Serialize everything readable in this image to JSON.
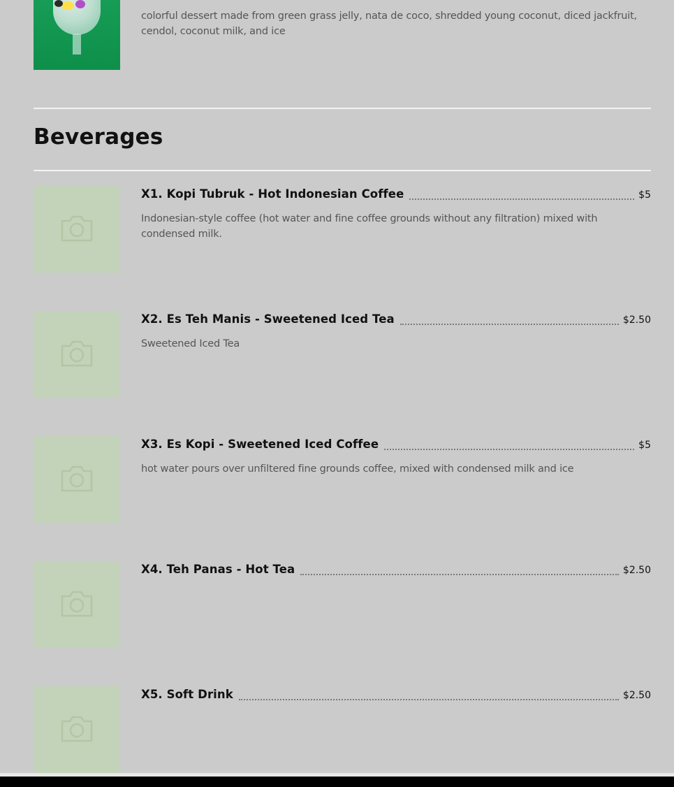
{
  "previous_item": {
    "description": "colorful dessert made from green grass jelly, nata de coco, shredded young coconut, diced jackfruit, cendol, coconut milk, and ice",
    "image_icon": "dessert-photo"
  },
  "section": {
    "title": "Beverages"
  },
  "items": [
    {
      "name": "X1. Kopi Tubruk - Hot Indonesian Coffee",
      "price": "$5",
      "description": "Indonesian-style coffee (hot water and fine coffee grounds without any filtration) mixed with condensed milk."
    },
    {
      "name": "X2. Es Teh Manis - Sweetened Iced Tea",
      "price": "$2.50",
      "description": "Sweetened Iced Tea"
    },
    {
      "name": "X3. Es Kopi - Sweetened Iced Coffee",
      "price": "$5",
      "description": "hot water pours over unfiltered fine grounds coffee, mixed with condensed milk and ice"
    },
    {
      "name": "X4. Teh Panas - Hot Tea",
      "price": "$2.50",
      "description": ""
    },
    {
      "name": "X5. Soft Drink",
      "price": "$2.50",
      "description": ""
    }
  ],
  "icons": {
    "placeholder": "camera-icon"
  },
  "colors": {
    "background": "#cbcbcb",
    "placeholder": "#c3d3b9",
    "divider": "#f3f3f3"
  }
}
